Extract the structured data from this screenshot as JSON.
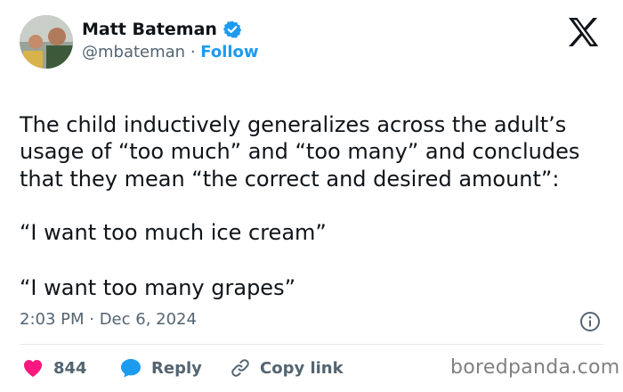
{
  "author": {
    "display_name": "Matt Bateman",
    "handle": "@mbateman",
    "separator": " · ",
    "follow_label": "Follow"
  },
  "tweet": {
    "text": "The child inductively generalizes across the adult’s usage of “too much” and “too many” and concludes that they mean “the correct and desired amount”:",
    "quote1": "“I want too much ice cream”",
    "quote2": "“I want too many grapes”",
    "timestamp": "2:03 PM · Dec 6, 2024"
  },
  "actions": {
    "like_count": "844",
    "reply_label": "Reply",
    "copy_link_label": "Copy link"
  },
  "watermark": "boredpanda.com",
  "colors": {
    "accent": "#1d9bf0",
    "like": "#f91880",
    "text": "#0f1419",
    "muted": "#536471"
  },
  "icons": [
    "verified-badge-icon",
    "x-logo-icon",
    "info-icon",
    "heart-icon",
    "reply-bubble-icon",
    "link-icon"
  ]
}
